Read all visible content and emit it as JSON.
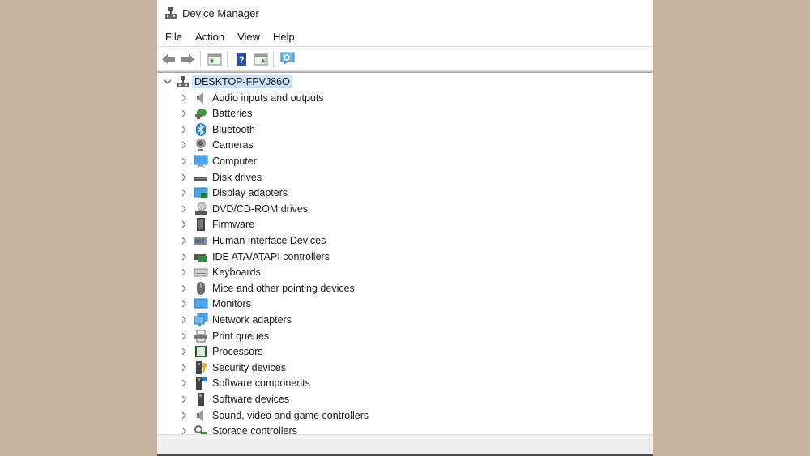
{
  "window": {
    "title": "Device Manager"
  },
  "menu": [
    {
      "label": "File"
    },
    {
      "label": "Action"
    },
    {
      "label": "View"
    },
    {
      "label": "Help"
    }
  ],
  "toolbar": [
    {
      "name": "back-button",
      "icon": "back-arrow-icon"
    },
    {
      "name": "forward-button",
      "icon": "forward-arrow-icon"
    },
    {
      "name": "show-hide-console-tree-button",
      "icon": "console-tree-icon"
    },
    {
      "name": "help-button",
      "icon": "help-icon"
    },
    {
      "name": "show-hide-action-pane-button",
      "icon": "action-pane-icon"
    },
    {
      "name": "scan-hardware-button",
      "icon": "monitor-scan-icon"
    }
  ],
  "tree": {
    "root": {
      "label": "DESKTOP-FPVJ86O",
      "expanded": true,
      "icon": "computer-network-icon"
    },
    "items": [
      {
        "label": "Audio inputs and outputs",
        "icon": "speaker-icon"
      },
      {
        "label": "Batteries",
        "icon": "battery-icon"
      },
      {
        "label": "Bluetooth",
        "icon": "bluetooth-icon"
      },
      {
        "label": "Cameras",
        "icon": "webcam-icon"
      },
      {
        "label": "Computer",
        "icon": "computer-icon"
      },
      {
        "label": "Disk drives",
        "icon": "disk-drive-icon"
      },
      {
        "label": "Display adapters",
        "icon": "display-adapter-icon"
      },
      {
        "label": "DVD/CD-ROM drives",
        "icon": "dvd-drive-icon"
      },
      {
        "label": "Firmware",
        "icon": "firmware-icon"
      },
      {
        "label": "Human Interface Devices",
        "icon": "hid-icon"
      },
      {
        "label": "IDE ATA/ATAPI controllers",
        "icon": "ide-controller-icon"
      },
      {
        "label": "Keyboards",
        "icon": "keyboard-icon"
      },
      {
        "label": "Mice and other pointing devices",
        "icon": "mouse-icon"
      },
      {
        "label": "Monitors",
        "icon": "monitor-icon"
      },
      {
        "label": "Network adapters",
        "icon": "network-adapter-icon"
      },
      {
        "label": "Print queues",
        "icon": "printer-icon"
      },
      {
        "label": "Processors",
        "icon": "processor-icon"
      },
      {
        "label": "Security devices",
        "icon": "security-device-icon"
      },
      {
        "label": "Software components",
        "icon": "software-component-icon"
      },
      {
        "label": "Software devices",
        "icon": "software-device-icon"
      },
      {
        "label": "Sound, video and game controllers",
        "icon": "sound-controller-icon"
      },
      {
        "label": "Storage controllers",
        "icon": "storage-controller-icon"
      }
    ]
  },
  "colors": {
    "background": "#c9b6a2",
    "selection": "#cce4f7"
  }
}
